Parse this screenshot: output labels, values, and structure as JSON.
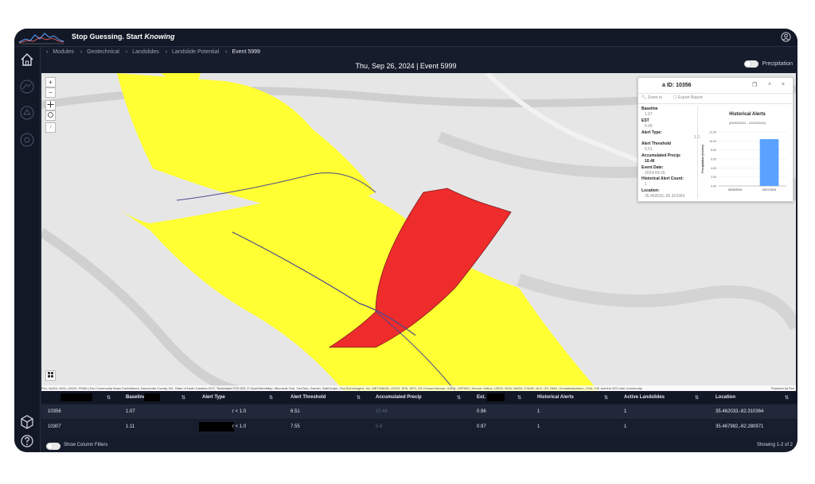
{
  "app": {
    "brand_prefix": "Stop Guessing. Start",
    "brand_emph": "Knowing"
  },
  "breadcrumb": [
    "Modules",
    "Geotechnical",
    "Landslides",
    "Landslide Potential",
    "Event 5999"
  ],
  "header": {
    "date_event": "Thu, Sep 26, 2024 | Event 5999",
    "precip_label": "Precipitation"
  },
  "icons": {
    "home": "home-icon",
    "user": "user-circle-icon",
    "cube": "cube-icon",
    "help": "help-icon"
  },
  "map": {
    "zoom_in": "+",
    "zoom_out": "−",
    "attribution": "Esri, NASA, NGA, USGS, FEMA | Esri Community Maps Contributors, Buncombe County, NC, State of North Carolina DOT, Tennessee STS GIS, © OpenStreetMap, Microsoft, Esri, TomTom, Garmin, SafeGraph, GeoTechnologies, Inc, METI/NASA, USGS, EPA, NPS, US Census Bureau, USDA, USFWS | Source: Airbus, USGS, NGA, NASA, CGIAR, NLS, OS, NMA, Geodatastyrelsen, GSA, GSI and the GIS User Community",
    "powered_by": "Powered by Esri",
    "colors": {
      "terrain": "#e6e6e6",
      "low": "#ffff33",
      "high": "#ef2c2c",
      "stream": "#4a4a8c"
    }
  },
  "popup": {
    "title": "a ID: 10356",
    "zoom_to": "Zoom to",
    "export_report": "Export Report",
    "fields": [
      {
        "label": "Baseline",
        "value": "1.07"
      },
      {
        "label": "EST",
        "value": "0.96"
      },
      {
        "label": "Alert Type:",
        "value": ""
      },
      {
        "label": "Alert Threshold",
        "value": "6.51"
      },
      {
        "label": "Accumulated Precip:",
        "value": "10.46"
      },
      {
        "label": "Event Date:",
        "value": "2024-09-26"
      },
      {
        "label": "Historical Alert Count:",
        "value": "1"
      },
      {
        "label": "Location:",
        "value": "35.462033,-82.310364"
      }
    ],
    "threshold_side": "1.0"
  },
  "chart_data": {
    "type": "bar",
    "title": "Historical Alerts",
    "subtitle": "(09/02/2024 - 12/02/2024)",
    "ylabel": "Precipitation (inches)",
    "categories": [
      "09/03/2024",
      "09/27/2024"
    ],
    "values": [
      0,
      10.4
    ],
    "yticks": [
      "12.00",
      "10.00",
      "8.00",
      "6.00",
      "4.00",
      "2.00",
      "0.00"
    ],
    "ylim": [
      0,
      12
    ],
    "bar_color": "#5aa2ff",
    "grid": true
  },
  "table": {
    "columns": [
      "",
      "Baseline",
      "Alert Type",
      "Alert Threshold",
      "Accumulated Precip",
      "Est.",
      "Historical Alerts",
      "Active Landslides",
      "Location"
    ],
    "rows": [
      [
        "10356",
        "1.07",
        "r < 1.0",
        "6.51",
        "10.46",
        "0.96",
        "1",
        "1",
        "35.462033,-82.310364"
      ],
      [
        "10307",
        "1.11",
        "r < 1.0",
        "7.55",
        "5.8",
        "0.97",
        "1",
        "1",
        "35.467982,-82.280971"
      ]
    ],
    "sort_glyph": "⇅"
  },
  "footer": {
    "show_filters": "Show Column Filters",
    "showing": "Showing 1-2 of 2"
  }
}
